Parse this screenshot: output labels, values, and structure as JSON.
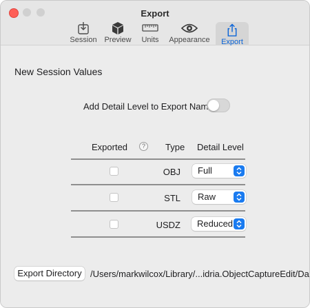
{
  "window": {
    "title": "Export"
  },
  "toolbar": {
    "items": [
      {
        "label": "Session",
        "icon": "session-icon"
      },
      {
        "label": "Preview",
        "icon": "cube-icon"
      },
      {
        "label": "Units",
        "icon": "ruler-icon"
      },
      {
        "label": "Appearance",
        "icon": "eye-icon"
      },
      {
        "label": "Export",
        "icon": "share-icon",
        "selected": true
      }
    ]
  },
  "section": {
    "title": "New Session Values",
    "detail_toggle_label": "Add Detail Level to Export Name",
    "detail_toggle_on": false
  },
  "table": {
    "headers": {
      "exported": "Exported",
      "help": "?",
      "type": "Type",
      "detail": "Detail Level"
    },
    "rows": [
      {
        "exported": false,
        "type": "OBJ",
        "detail": "Full"
      },
      {
        "exported": false,
        "type": "STL",
        "detail": "Raw"
      },
      {
        "exported": false,
        "type": "USDZ",
        "detail": "Reduced"
      }
    ]
  },
  "export_directory": {
    "button_label": "Export Directory",
    "path": "/Users/markwilcox/Library/...idria.ObjectCaptureEdit/Data"
  },
  "colors": {
    "accent": "#1a7bf0",
    "close": "#fe5f57"
  }
}
